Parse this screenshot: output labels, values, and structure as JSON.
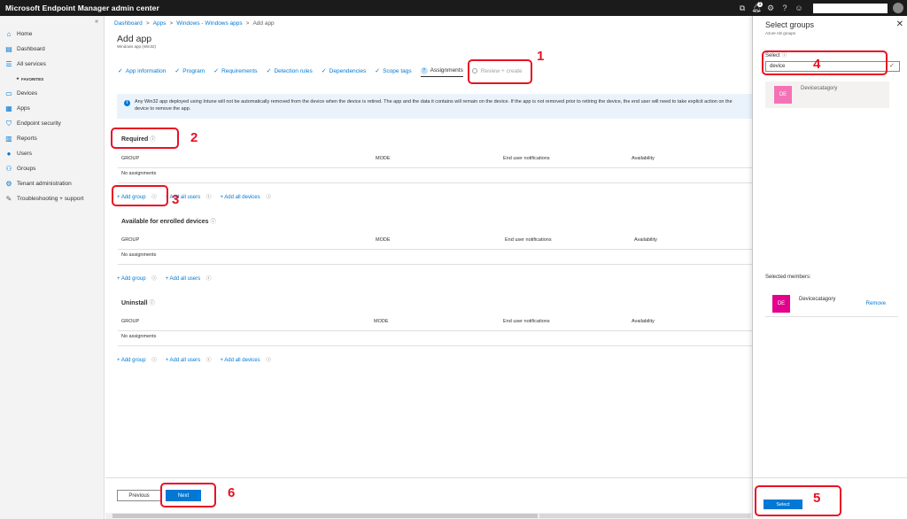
{
  "app": {
    "title": "Microsoft Endpoint Manager admin center",
    "notification_count": "1"
  },
  "topbar_icons": [
    "portal-icon",
    "bell-icon",
    "gear-icon",
    "help-icon",
    "smiley-icon",
    "user-avatar"
  ],
  "sidebar": {
    "collapse": "«",
    "favorites_label": "FAVORITES",
    "items": [
      {
        "label": "Home",
        "icon": "home-icon"
      },
      {
        "label": "Dashboard",
        "icon": "dashboard-icon"
      },
      {
        "label": "All services",
        "icon": "list-icon"
      },
      {
        "label": "Devices",
        "icon": "devices-icon"
      },
      {
        "label": "Apps",
        "icon": "apps-icon"
      },
      {
        "label": "Endpoint security",
        "icon": "shield-icon"
      },
      {
        "label": "Reports",
        "icon": "reports-icon"
      },
      {
        "label": "Users",
        "icon": "users-icon"
      },
      {
        "label": "Groups",
        "icon": "groups-icon"
      },
      {
        "label": "Tenant administration",
        "icon": "tenant-icon"
      },
      {
        "label": "Troubleshooting + support",
        "icon": "wrench-icon"
      }
    ]
  },
  "breadcrumb": {
    "items": [
      "Dashboard",
      "Apps",
      "Windows - Windows apps"
    ],
    "current": "Add app",
    "separator": ">"
  },
  "page": {
    "title": "Add app",
    "subtitle": "Windows app (Win32)"
  },
  "steps": [
    {
      "label": "App information",
      "state": "done"
    },
    {
      "label": "Program",
      "state": "done"
    },
    {
      "label": "Requirements",
      "state": "done"
    },
    {
      "label": "Detection rules",
      "state": "done"
    },
    {
      "label": "Dependencies",
      "state": "done"
    },
    {
      "label": "Scope tags",
      "state": "done"
    },
    {
      "label": "Assignments",
      "state": "active"
    },
    {
      "label": "Review + create",
      "state": "disabled"
    }
  ],
  "info_banner": "Any Win32 app deployed using Intune will not be automatically removed from the device when the device is retired. The app and the data it contains will remain on the device. If the app is not removed prior to retiring the device, the end user will need to take explicit action on the device to remove the app.",
  "columns": {
    "group": "GROUP",
    "mode": "MODE",
    "notifications": "End user notifications",
    "availability": "Availability"
  },
  "sections": {
    "required": {
      "title": "Required",
      "empty": "No assignments",
      "links": [
        "+ Add group",
        "+ Add all users",
        "+ Add all devices"
      ]
    },
    "available": {
      "title": "Available for enrolled devices",
      "empty": "No assignments",
      "links": [
        "+ Add group",
        "+ Add all users"
      ]
    },
    "uninstall": {
      "title": "Uninstall",
      "empty": "No assignments",
      "links": [
        "+ Add group",
        "+ Add all users",
        "+ Add all devices"
      ]
    }
  },
  "footer": {
    "previous": "Previous",
    "next": "Next"
  },
  "blade": {
    "title": "Select groups",
    "subtitle": "Azure AD groups",
    "select_label": "Select",
    "search_value": "device",
    "result": {
      "initials": "DE",
      "name": "Devicecatagory"
    },
    "selected_members_label": "Selected members:",
    "member": {
      "initials": "DE",
      "name": "Devicecatagory",
      "remove": "Remove"
    },
    "select_button": "Select"
  },
  "annotations": [
    "1",
    "2",
    "3",
    "4",
    "5",
    "6"
  ],
  "colors": {
    "accent": "#0078d4",
    "annotation": "#e81123",
    "tile": "#e3008c"
  }
}
